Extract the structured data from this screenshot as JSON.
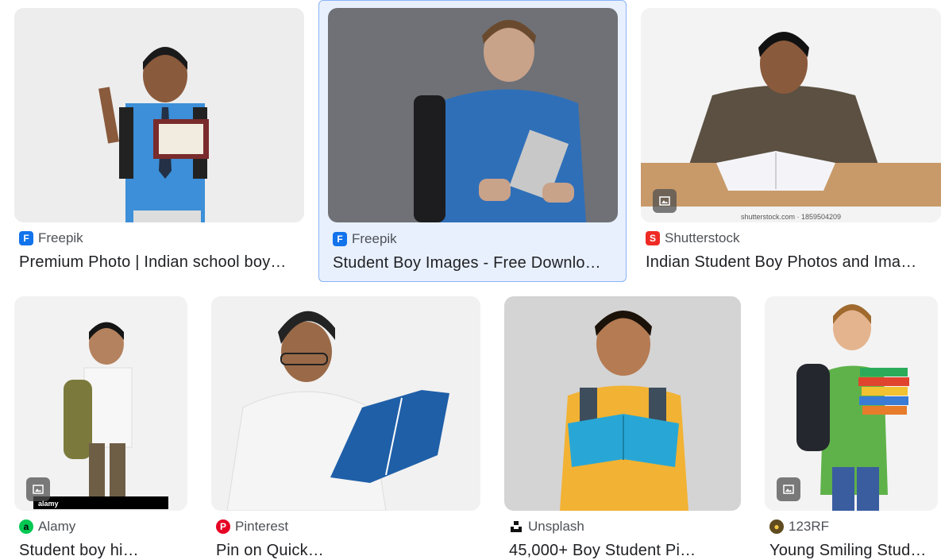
{
  "results": [
    {
      "source": "Freepik",
      "title": "Premium Photo | Indian school boy…",
      "icon": "freepik-icon",
      "icon_color": "#1273eb"
    },
    {
      "source": "Freepik",
      "title": "Student Boy Images - Free Downlo…",
      "icon": "freepik-icon",
      "icon_color": "#1273eb",
      "selected": true
    },
    {
      "source": "Shutterstock",
      "title": "Indian Student Boy Photos and Ima…",
      "icon": "shutterstock-icon",
      "icon_color": "#ee2b24",
      "watermark": "shutterstock.com · 1859504209"
    },
    {
      "source": "Alamy",
      "title": "Student boy hi…",
      "icon": "alamy-icon",
      "icon_color": "#00c853",
      "watermark": "alamy"
    },
    {
      "source": "Pinterest",
      "title": "Pin on Quick…",
      "icon": "pinterest-icon",
      "icon_color": "#e60023"
    },
    {
      "source": "Unsplash",
      "title": "45,000+ Boy Student Pi…",
      "icon": "unsplash-icon",
      "icon_color": "#111111"
    },
    {
      "source": "123RF",
      "title": "Young Smiling Stud…",
      "icon": "123rf-icon",
      "icon_color": "#5f4b1e"
    }
  ]
}
